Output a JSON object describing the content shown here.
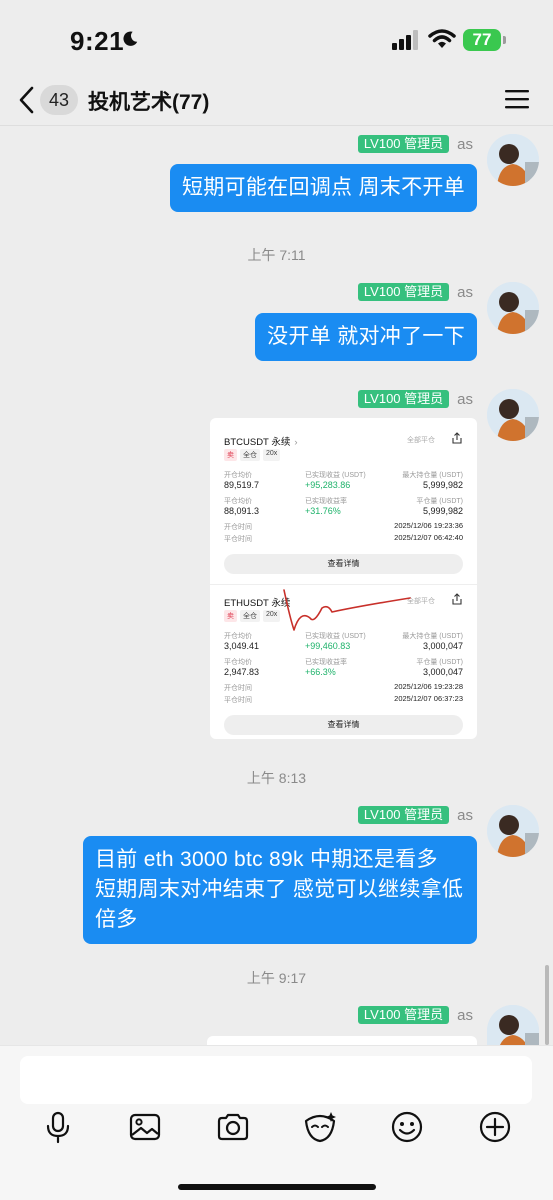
{
  "status_bar": {
    "time": "9:21",
    "battery": "77"
  },
  "header": {
    "unread_count": "43",
    "title": "投机艺术(77)"
  },
  "sender": {
    "level": "LV100 管理员",
    "name": "as"
  },
  "messages": {
    "m1": "短期可能在回调点 周末不开单",
    "t1": "上午 7:11",
    "m2": "没开单 就对冲了一下",
    "m4": "目前 eth 3000 btc 89k 中期还是看多 短期周末对冲结束了 感觉可以继续拿低倍多",
    "t2": "上午 8:13",
    "t3": "上午 9:17"
  },
  "position_card": {
    "close_all": "全部平仓",
    "detail_button": "查看详情",
    "labels": {
      "open_avg": "开仓均价",
      "realized_pnl": "已实现收益 (USDT)",
      "max_hold": "最大持仓量 (USDT)",
      "close_avg": "平仓均价",
      "realized_rate": "已实现收益率",
      "close_amount": "平仓量 (USDT)",
      "open_time": "开仓时间",
      "close_time": "平仓时间"
    },
    "positions": [
      {
        "symbol": "BTCUSDT 永续",
        "side": "卖",
        "margin": "全仓",
        "leverage": "20x",
        "open_avg": "89,519.7",
        "realized_pnl": "+95,283.86",
        "max_hold": "5,999,982",
        "close_avg": "88,091.3",
        "realized_rate": "+31.76%",
        "close_amount": "5,999,982",
        "open_time": "2025/12/06 19:23:36",
        "close_time": "2025/12/07 06:42:40"
      },
      {
        "symbol": "ETHUSDT 永续",
        "side": "卖",
        "margin": "全仓",
        "leverage": "20x",
        "open_avg": "3,049.41",
        "realized_pnl": "+99,460.83",
        "max_hold": "3,000,047",
        "close_avg": "2,947.83",
        "realized_rate": "+66.3%",
        "close_amount": "3,000,047",
        "open_time": "2025/12/06 19:23:28",
        "close_time": "2025/12/07 06:37:23"
      }
    ]
  },
  "toolbar": {
    "icons": [
      "microphone-icon",
      "image-icon",
      "camera-icon",
      "sticker-icon",
      "emoji-icon",
      "plus-icon"
    ]
  },
  "colors": {
    "bubble": "#1a8cf2",
    "badge": "#36c07e",
    "profit": "#1fb36b",
    "sell_tag": "#e0475a"
  }
}
